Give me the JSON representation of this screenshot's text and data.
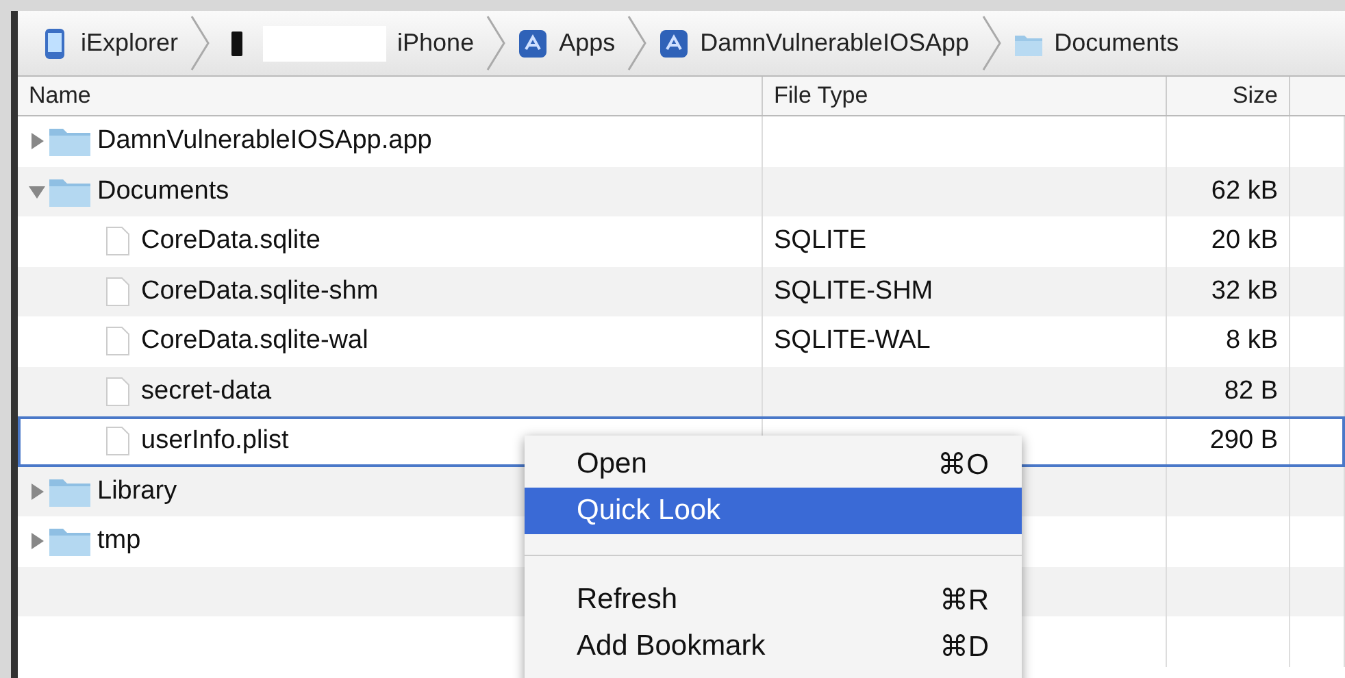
{
  "breadcrumb": [
    {
      "label": "iExplorer",
      "kind": "app"
    },
    {
      "label": "iPhone",
      "kind": "device"
    },
    {
      "label": "Apps",
      "kind": "store"
    },
    {
      "label": "DamnVulnerableIOSApp",
      "kind": "store"
    },
    {
      "label": "Documents",
      "kind": "folder"
    }
  ],
  "table": {
    "columns": [
      "Name",
      "File Type",
      "Size"
    ],
    "rows": [
      {
        "kind": "folder",
        "name": "DamnVulnerableIOSApp.app",
        "expanded": false,
        "selected": false
      },
      {
        "kind": "folder",
        "name": "Documents",
        "size": "62 kB",
        "expanded": true,
        "selected": false,
        "children": [
          {
            "kind": "file",
            "name": "CoreData.sqlite",
            "type": "SQLITE",
            "size": "20 kB",
            "selected": false
          },
          {
            "kind": "file",
            "name": "CoreData.sqlite-shm",
            "type": "SQLITE-SHM",
            "size": "32 kB",
            "selected": false
          },
          {
            "kind": "file",
            "name": "CoreData.sqlite-wal",
            "type": "SQLITE-WAL",
            "size": "8 kB",
            "selected": false
          },
          {
            "kind": "file",
            "name": "secret-data",
            "size": "82 B",
            "selected": false
          },
          {
            "kind": "file",
            "name": "userInfo.plist",
            "size": "290 B",
            "selected": true
          }
        ]
      },
      {
        "kind": "folder",
        "name": "Library",
        "expanded": false,
        "selected": false
      },
      {
        "kind": "folder",
        "name": "tmp",
        "expanded": false,
        "selected": false
      }
    ]
  },
  "context_menu": [
    {
      "kind": "item",
      "label": "Open",
      "shortcut": "⌘O",
      "selected": false
    },
    {
      "kind": "item",
      "label": "Quick Look",
      "selected": true
    },
    {
      "kind": "separator"
    },
    {
      "kind": "item",
      "label": "Refresh",
      "shortcut": "⌘R",
      "selected": false
    },
    {
      "kind": "item",
      "label": "Add Bookmark",
      "shortcut": "⌘D",
      "selected": false
    }
  ]
}
